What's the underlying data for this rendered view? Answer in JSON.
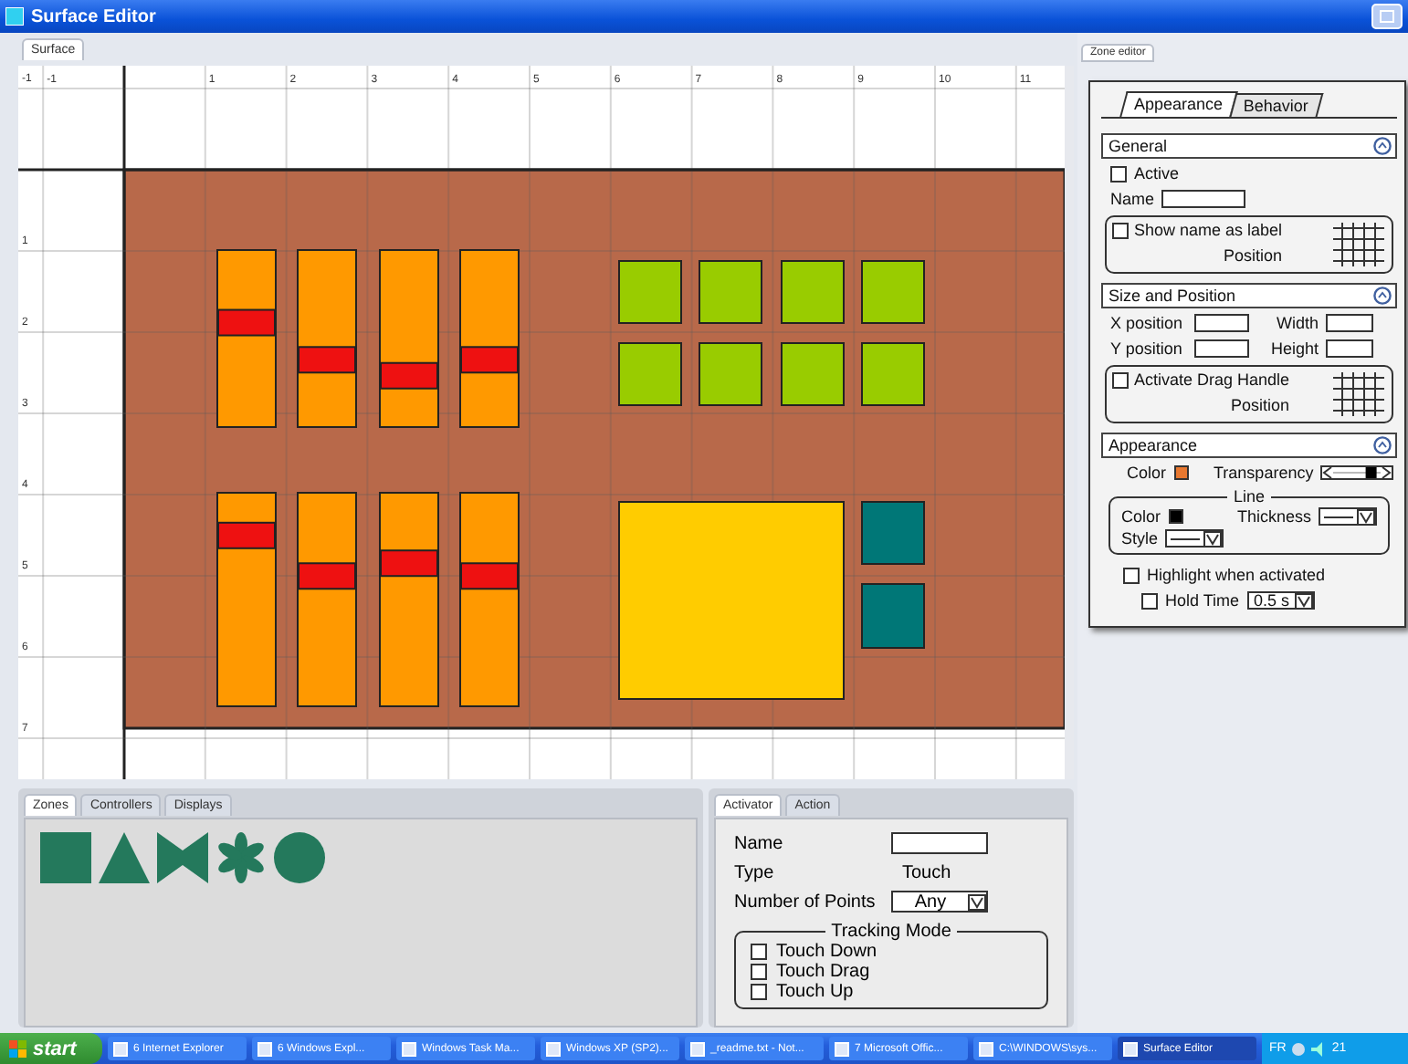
{
  "window": {
    "title": "Surface Editor"
  },
  "surface": {
    "tab": "Surface",
    "column_labels": [
      "-1",
      "1",
      "2",
      "3",
      "4",
      "5",
      "6",
      "7",
      "8",
      "9",
      "10",
      "11"
    ],
    "row_labels": [
      "-1",
      "1",
      "2",
      "3",
      "4",
      "5",
      "6",
      "7"
    ],
    "zones": [
      {
        "kind": "slider",
        "color": "#ff9900",
        "level": 0.59
      },
      {
        "kind": "slider",
        "color": "#ff9900",
        "level": 0.38
      },
      {
        "kind": "slider",
        "color": "#ff9900",
        "level": 0.29
      },
      {
        "kind": "slider",
        "color": "#ff9900",
        "level": 0.38
      },
      {
        "kind": "button",
        "color": "#99cc00"
      },
      {
        "kind": "button",
        "color": "#99cc00"
      },
      {
        "kind": "button",
        "color": "#99cc00"
      },
      {
        "kind": "button",
        "color": "#99cc00"
      },
      {
        "kind": "button",
        "color": "#99cc00"
      },
      {
        "kind": "button",
        "color": "#99cc00"
      },
      {
        "kind": "button",
        "color": "#99cc00"
      },
      {
        "kind": "button",
        "color": "#99cc00"
      },
      {
        "kind": "slider",
        "color": "#ff9900",
        "level": 0.8
      },
      {
        "kind": "slider",
        "color": "#ff9900",
        "level": 0.61
      },
      {
        "kind": "slider",
        "color": "#ff9900",
        "level": 0.67
      },
      {
        "kind": "slider",
        "color": "#ff9900",
        "level": 0.61
      },
      {
        "kind": "pad",
        "color": "#ffcc00"
      },
      {
        "kind": "button",
        "color": "#007777"
      },
      {
        "kind": "button",
        "color": "#007777"
      }
    ]
  },
  "zone_editor": {
    "tab": "Zone editor",
    "tabs": [
      {
        "label": "Appearance",
        "selected": true
      },
      {
        "label": "Behavior",
        "selected": false
      }
    ],
    "general": {
      "title": "General",
      "active": {
        "label": "Active",
        "checked": false
      },
      "name_label": "Name",
      "show_name": {
        "label": "Show name as label",
        "checked": false
      },
      "position_label": "Position"
    },
    "size_position": {
      "title": "Size and Position",
      "x_label": "X position",
      "width_label": "Width",
      "y_label": "Y position",
      "height_label": "Height",
      "drag_handle": {
        "label": "Activate Drag Handle",
        "checked": false
      },
      "position_label": "Position"
    },
    "appearance": {
      "title": "Appearance",
      "color_label": "Color",
      "color": "#e87830",
      "transparency": {
        "label": "Transparency",
        "level": 0.8
      },
      "line": {
        "title": "Line",
        "color_label": "Color",
        "color": "#000000",
        "thickness_label": "Thickness",
        "style_label": "Style"
      },
      "highlight": {
        "label": "Highlight when activated",
        "checked": false
      },
      "hold_time": {
        "label": "Hold Time",
        "checked": false,
        "value": "0.5 s"
      }
    }
  },
  "library": {
    "tabs": [
      {
        "label": "Zones",
        "selected": true
      },
      {
        "label": "Controllers",
        "selected": false
      },
      {
        "label": "Displays",
        "selected": false
      }
    ]
  },
  "activator": {
    "tabs": [
      {
        "label": "Activator",
        "selected": true
      },
      {
        "label": "Action",
        "selected": false
      }
    ],
    "name_label": "Name",
    "type_label": "Type",
    "type_value": "Touch",
    "points_label": "Number of Points",
    "points_value": "Any",
    "tracking": {
      "title": "Tracking Mode",
      "options": [
        {
          "label": "Touch Down",
          "checked": false
        },
        {
          "label": "Touch Drag",
          "checked": false
        },
        {
          "label": "Touch Up",
          "checked": false
        }
      ]
    }
  },
  "taskbar": {
    "start": "start",
    "items": [
      {
        "label": "6 Internet Explorer",
        "selected": false
      },
      {
        "label": "6 Windows Expl...",
        "selected": false
      },
      {
        "label": "Windows Task Ma...",
        "selected": false
      },
      {
        "label": "Windows XP (SP2)...",
        "selected": false
      },
      {
        "label": "_readme.txt - Not...",
        "selected": false
      },
      {
        "label": "7 Microsoft Offic...",
        "selected": false
      },
      {
        "label": "C:\\WINDOWS\\sys...",
        "selected": false
      },
      {
        "label": "Surface Editor",
        "selected": true
      }
    ],
    "language": "FR",
    "clock": "21"
  }
}
